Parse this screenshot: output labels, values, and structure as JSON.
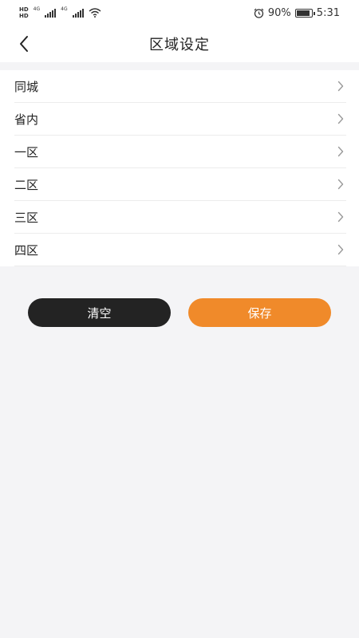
{
  "status_bar": {
    "hd1": "HD",
    "hd2": "HD",
    "net1": "4G",
    "net2": "4G",
    "battery_percent": "90%",
    "battery_level": 0.9,
    "time": "5:31",
    "icons": [
      "signal-icon",
      "wifi-icon",
      "alarm-icon",
      "battery-icon"
    ]
  },
  "nav": {
    "title": "区域设定",
    "back_icon": "chevron-left-icon"
  },
  "regions": [
    {
      "label": "同城"
    },
    {
      "label": "省内"
    },
    {
      "label": "一区"
    },
    {
      "label": "二区"
    },
    {
      "label": "三区"
    },
    {
      "label": "四区"
    }
  ],
  "actions": {
    "clear_label": "清空",
    "save_label": "保存"
  },
  "colors": {
    "background": "#f4f4f6",
    "clear_button": "#232323",
    "save_button": "#f08a2a",
    "chevron": "#9a9a9a"
  }
}
